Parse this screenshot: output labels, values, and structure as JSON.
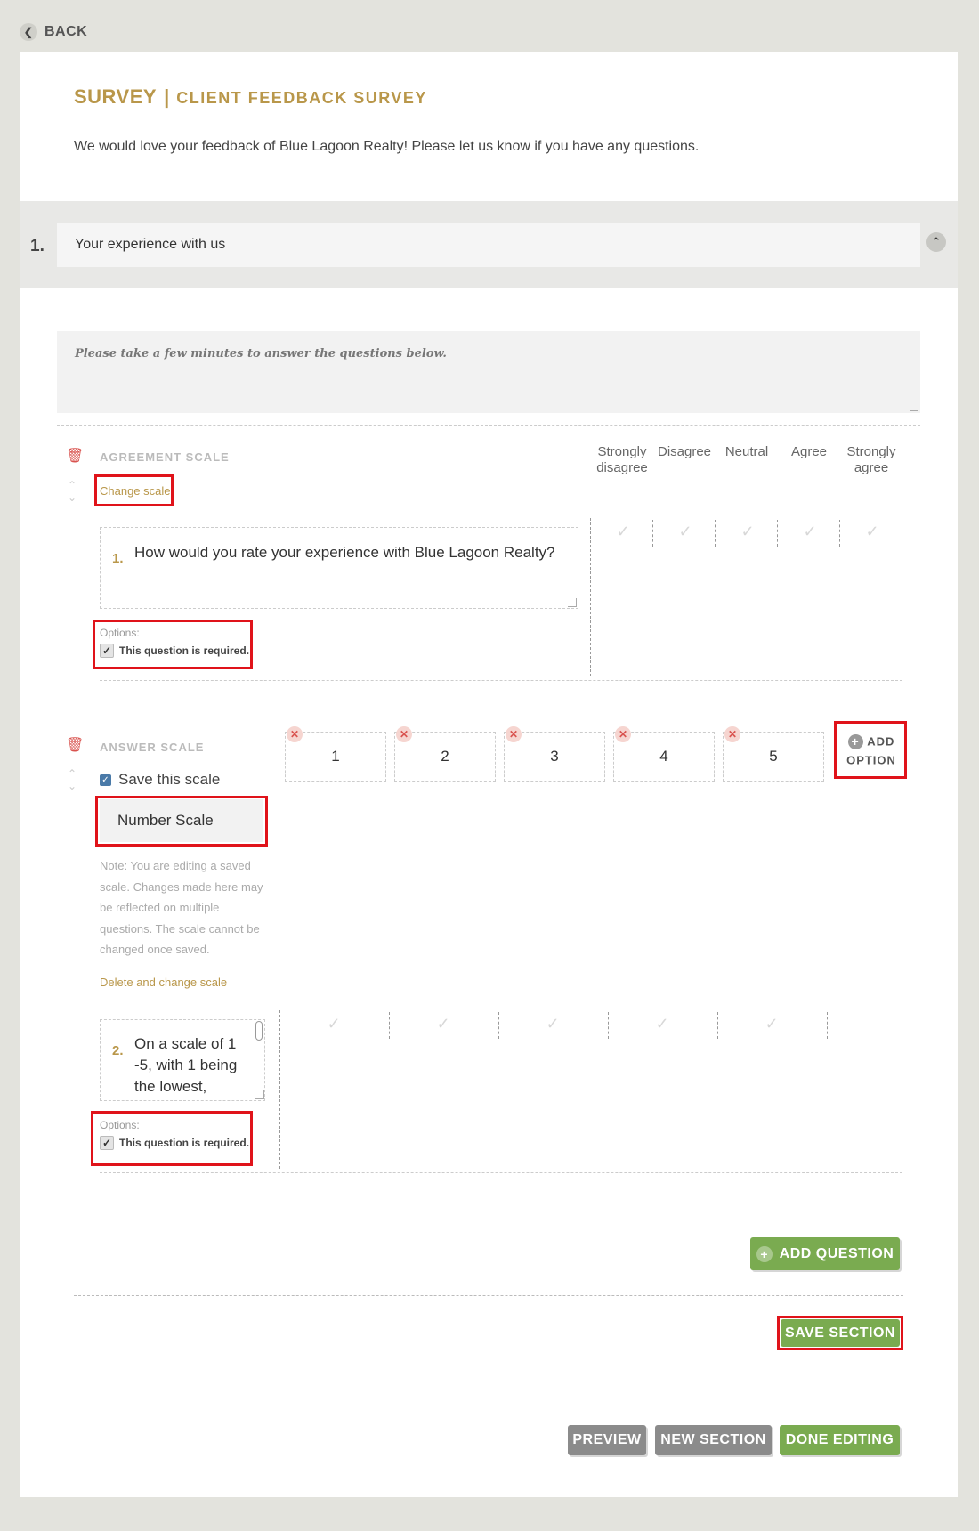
{
  "back_label": "BACK",
  "header": {
    "survey_label": "SURVEY",
    "separator": "|",
    "survey_name": "CLIENT FEEDBACK SURVEY",
    "description": "We would love your feedback of Blue Lagoon Realty! Please let us know if you have any questions."
  },
  "section": {
    "number": "1.",
    "title": "Your experience with us",
    "intro": "Please take a few minutes to answer the questions below."
  },
  "question1": {
    "type_label": "AGREEMENT SCALE",
    "change_scale": "Change scale",
    "number": "1.",
    "text": "How would you rate your experience with Blue Lagoon Realty?",
    "options_label": "Options:",
    "required_label": "This question is required.",
    "scale_headers": [
      "Strongly disagree",
      "Disagree",
      "Neutral",
      "Agree",
      "Strongly agree"
    ]
  },
  "question2": {
    "type_label": "ANSWER SCALE",
    "save_scale_label": "Save this scale",
    "scale_name": "Number Scale",
    "note": "Note: You are editing a saved scale. Changes made here may be reflected on multiple questions. The scale cannot be changed once saved.",
    "delete_change": "Delete and change scale",
    "answers": [
      "1",
      "2",
      "3",
      "4",
      "5"
    ],
    "add_option": "ADD OPTION",
    "number": "2.",
    "text": "On a scale of 1 -5, with 1 being the lowest,",
    "options_label": "Options:",
    "required_label": "This question is required."
  },
  "buttons": {
    "add_question": "ADD QUESTION",
    "save_section": "SAVE SECTION",
    "preview": "PREVIEW",
    "new_section": "NEW SECTION",
    "done_editing": "DONE EDITING"
  },
  "colors": {
    "gold": "#b9974a",
    "green": "#7aab50",
    "grey_button": "#8b8b8b",
    "highlight_red": "#e0131a",
    "trash_red": "#d9534f"
  }
}
